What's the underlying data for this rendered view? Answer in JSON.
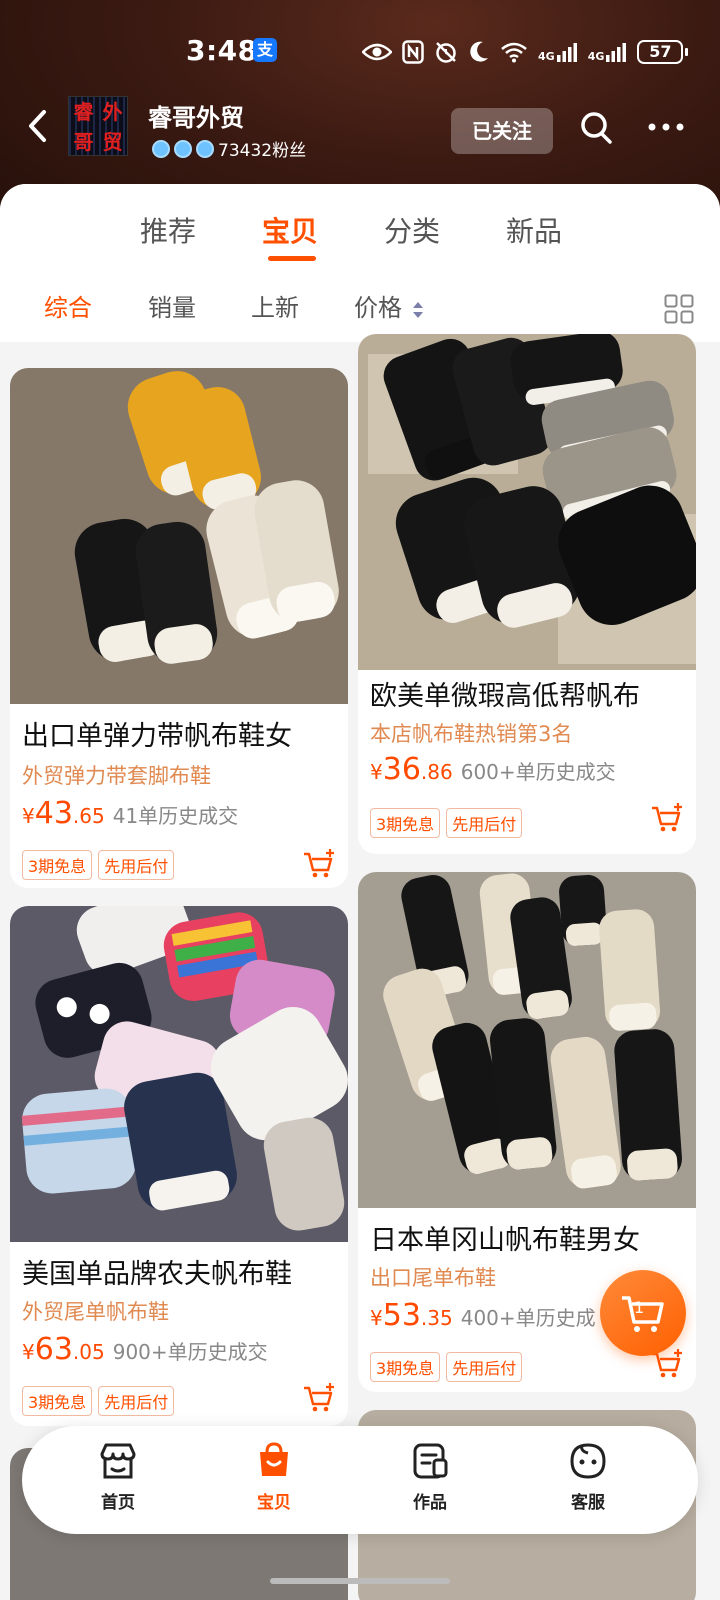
{
  "status_bar": {
    "time": "3:48",
    "alipay_badge": "支",
    "network_1": "4G",
    "network_2": "4G",
    "battery": "57"
  },
  "shop": {
    "logo_chars": [
      "睿",
      "外",
      "哥",
      "贸"
    ],
    "name": "睿哥外贸",
    "followers": "73432粉丝",
    "follow_label": "已关注"
  },
  "tabs": [
    "推荐",
    "宝贝",
    "分类",
    "新品"
  ],
  "active_tab": "宝贝",
  "sort": [
    "综合",
    "销量",
    "上新",
    "价格"
  ],
  "active_sort": "综合",
  "products": [
    {
      "title": "出口单弹力带帆布鞋女",
      "subtitle": "外贸弹力带套脚布鞋",
      "price_yen": "¥",
      "price_int": "43",
      "price_dec": ".65",
      "sold": "41单历史成交",
      "tags": [
        "3期免息",
        "先用后付"
      ]
    },
    {
      "title": "欧美单微瑕高低帮帆布",
      "subtitle": "本店帆布鞋热销第3名",
      "price_yen": "¥",
      "price_int": "36",
      "price_dec": ".86",
      "sold": "600+单历史成交",
      "tags": [
        "3期免息",
        "先用后付"
      ]
    },
    {
      "title": "美国单品牌农夫帆布鞋",
      "subtitle": "外贸尾单帆布鞋",
      "price_yen": "¥",
      "price_int": "63",
      "price_dec": ".05",
      "sold": "900+单历史成交",
      "tags": [
        "3期免息",
        "先用后付"
      ]
    },
    {
      "title": "日本单冈山帆布鞋男女",
      "subtitle": "出口尾单布鞋",
      "price_yen": "¥",
      "price_int": "53",
      "price_dec": ".35",
      "sold": "400+单历史成",
      "tags": [
        "3期免息",
        "先用后付"
      ]
    }
  ],
  "floating_cart_count": "1",
  "bottom_nav": [
    "首页",
    "宝贝",
    "作品",
    "客服"
  ],
  "active_nav": "宝贝",
  "colors": {
    "accent": "#ff5000",
    "subtitle": "#e08a52",
    "header": "#3b1a12"
  }
}
